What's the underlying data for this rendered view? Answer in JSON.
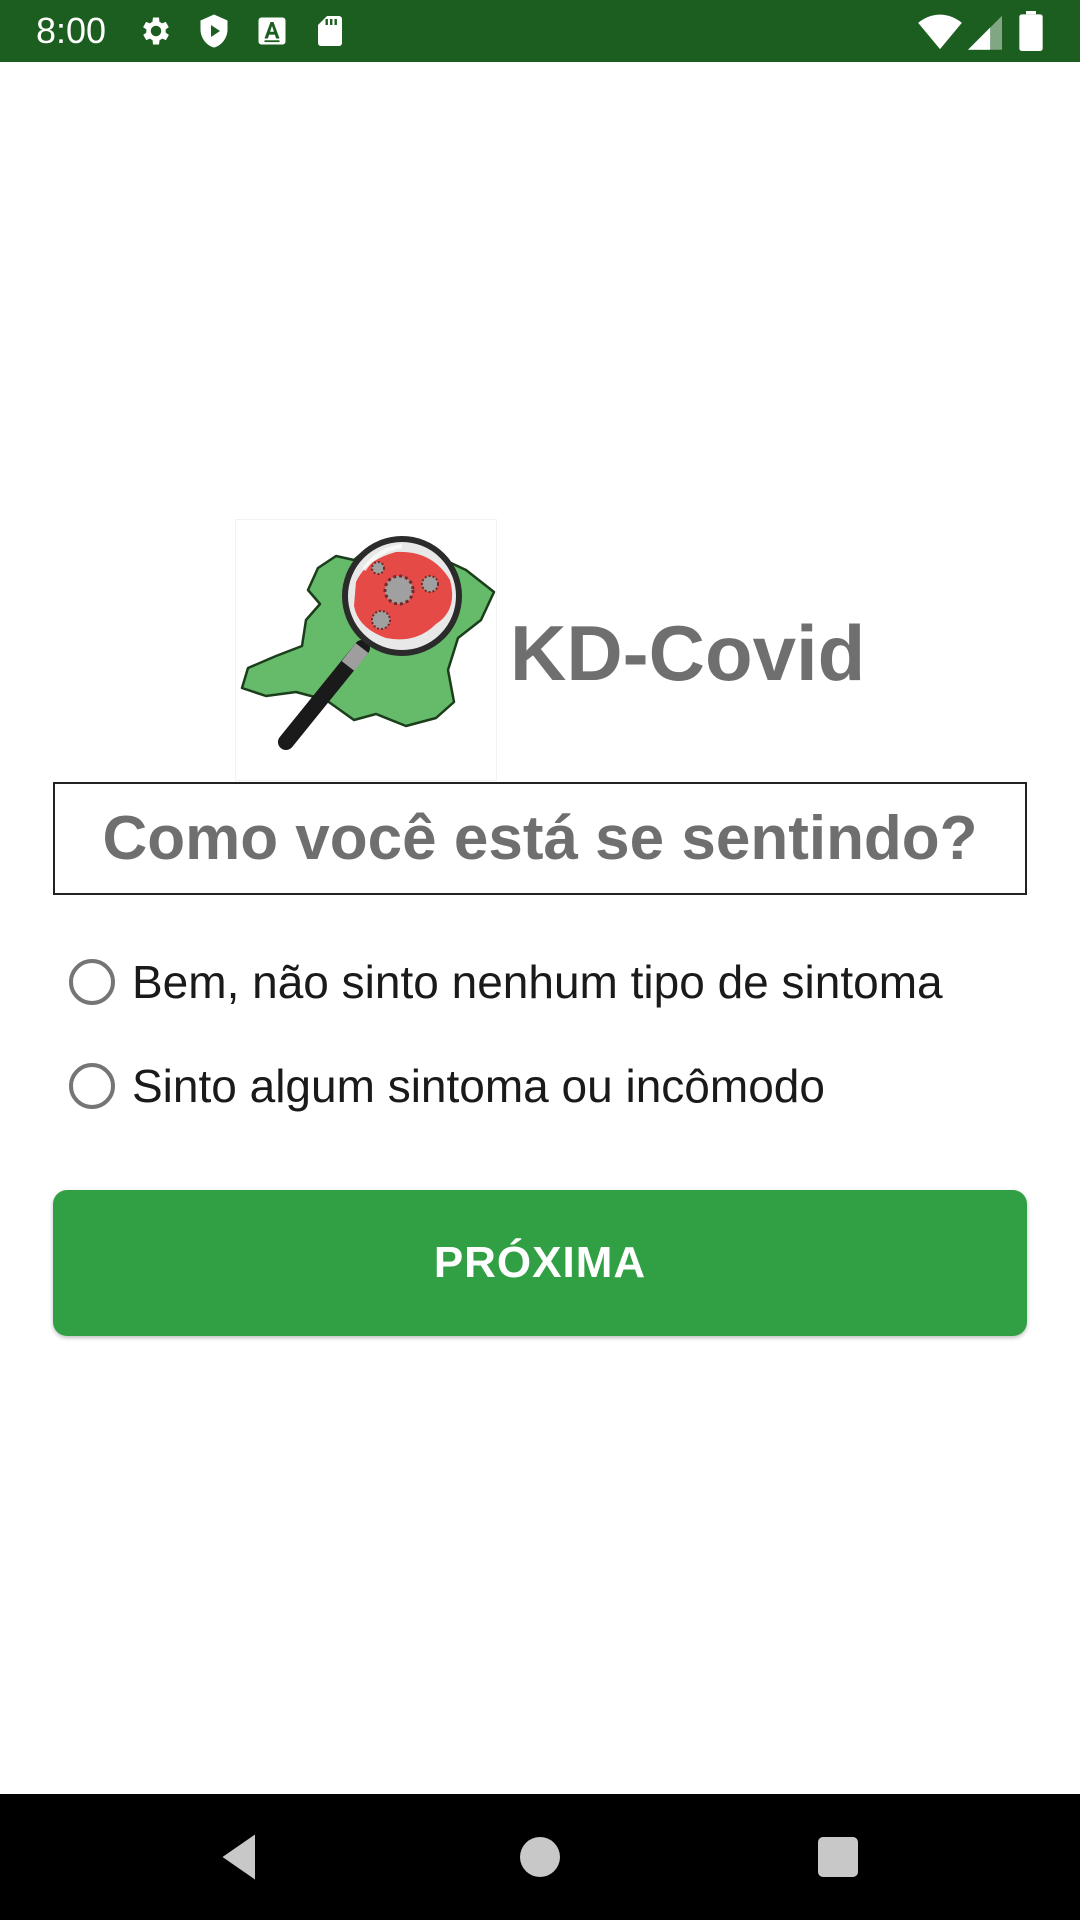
{
  "status_bar": {
    "time": "8:00",
    "background": "#1b5e20",
    "left_icons": [
      "settings-icon",
      "shield-play-icon",
      "font-a-icon",
      "sd-card-icon"
    ],
    "right_icons": [
      "wifi-icon",
      "cell-signal-icon",
      "battery-icon"
    ]
  },
  "header": {
    "logo_icon": "kd-covid-logo",
    "title": "KD-Covid"
  },
  "question": {
    "text": "Como você está se sentindo?"
  },
  "options": [
    {
      "label": "Bem, não sinto nenhum tipo de sintoma",
      "selected": false
    },
    {
      "label": "Sinto algum sintoma ou incômodo",
      "selected": false
    }
  ],
  "next_button": {
    "label": "PRÓXIMA",
    "color": "#31a044"
  },
  "nav_bar": {
    "buttons": [
      "back-icon",
      "home-icon",
      "recents-icon"
    ]
  }
}
